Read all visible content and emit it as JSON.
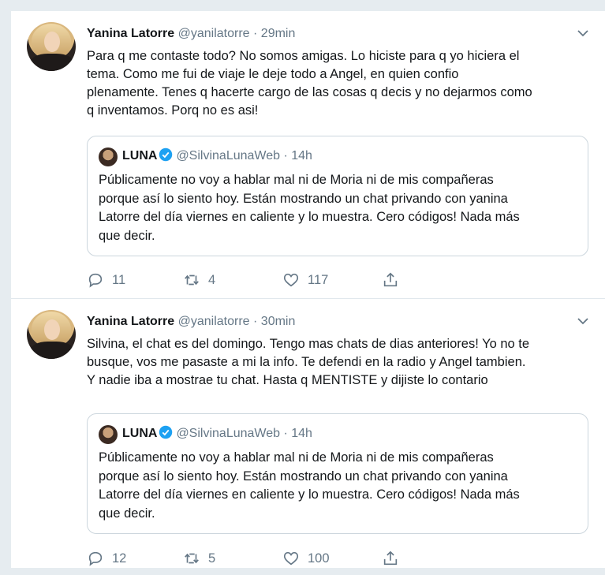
{
  "tweets": [
    {
      "author": {
        "name": "Yanina Latorre",
        "handle": "@yanilatorre"
      },
      "separator": "·",
      "time": "29min",
      "text_lines": [
        "Para q me contaste todo? No somos amigas. Lo hiciste para q yo hiciera el",
        "tema. Como me fui de viaje le deje todo a Angel, en quien confio",
        "plenamente. Tenes q hacerte cargo de las cosas q decis y no dejarmos como",
        "q inventamos. Porq no es asi!"
      ],
      "quote": {
        "name": "LUNA",
        "handle": "@SilvinaLunaWeb",
        "separator": "·",
        "time": "14h",
        "text_lines": [
          "Públicamente no voy a hablar mal ni de Moria ni de mis compañeras",
          "porque así lo siento hoy. Están mostrando un chat privando con yanina",
          "Latorre del día viernes en caliente y lo muestra. Cero códigos! Nada más",
          "que decir."
        ]
      },
      "actions": {
        "replies": "11",
        "retweets": "4",
        "likes": "117"
      }
    },
    {
      "author": {
        "name": "Yanina Latorre",
        "handle": "@yanilatorre"
      },
      "separator": "·",
      "time": "30min",
      "text_lines": [
        "Silvina, el chat es del domingo. Tengo mas chats de dias anteriores! Yo no te",
        "busque, vos me pasaste a mi la info. Te defendi en la radio y Angel tambien.",
        "Y nadie iba a mostrae tu chat. Hasta q MENTISTE y dijiste lo contario"
      ],
      "quote": {
        "name": "LUNA",
        "handle": "@SilvinaLunaWeb",
        "separator": "·",
        "time": "14h",
        "text_lines": [
          "Públicamente no voy a hablar mal ni de Moria ni de mis compañeras",
          "porque así lo siento hoy. Están mostrando un chat privando con yanina",
          "Latorre del día viernes en caliente y lo muestra. Cero códigos! Nada más",
          "que decir."
        ]
      },
      "actions": {
        "replies": "12",
        "retweets": "5",
        "likes": "100"
      }
    }
  ],
  "icons": {
    "reply": "reply-icon",
    "retweet": "retweet-icon",
    "like": "heart-icon",
    "share": "share-icon",
    "caret": "chevron-down-icon",
    "verified": "verified-badge-icon"
  },
  "colors": {
    "verified": "#1da1f2",
    "muted": "#657786",
    "text": "#14171a",
    "border": "#ccd6dd",
    "background": "#e6ecf0"
  }
}
